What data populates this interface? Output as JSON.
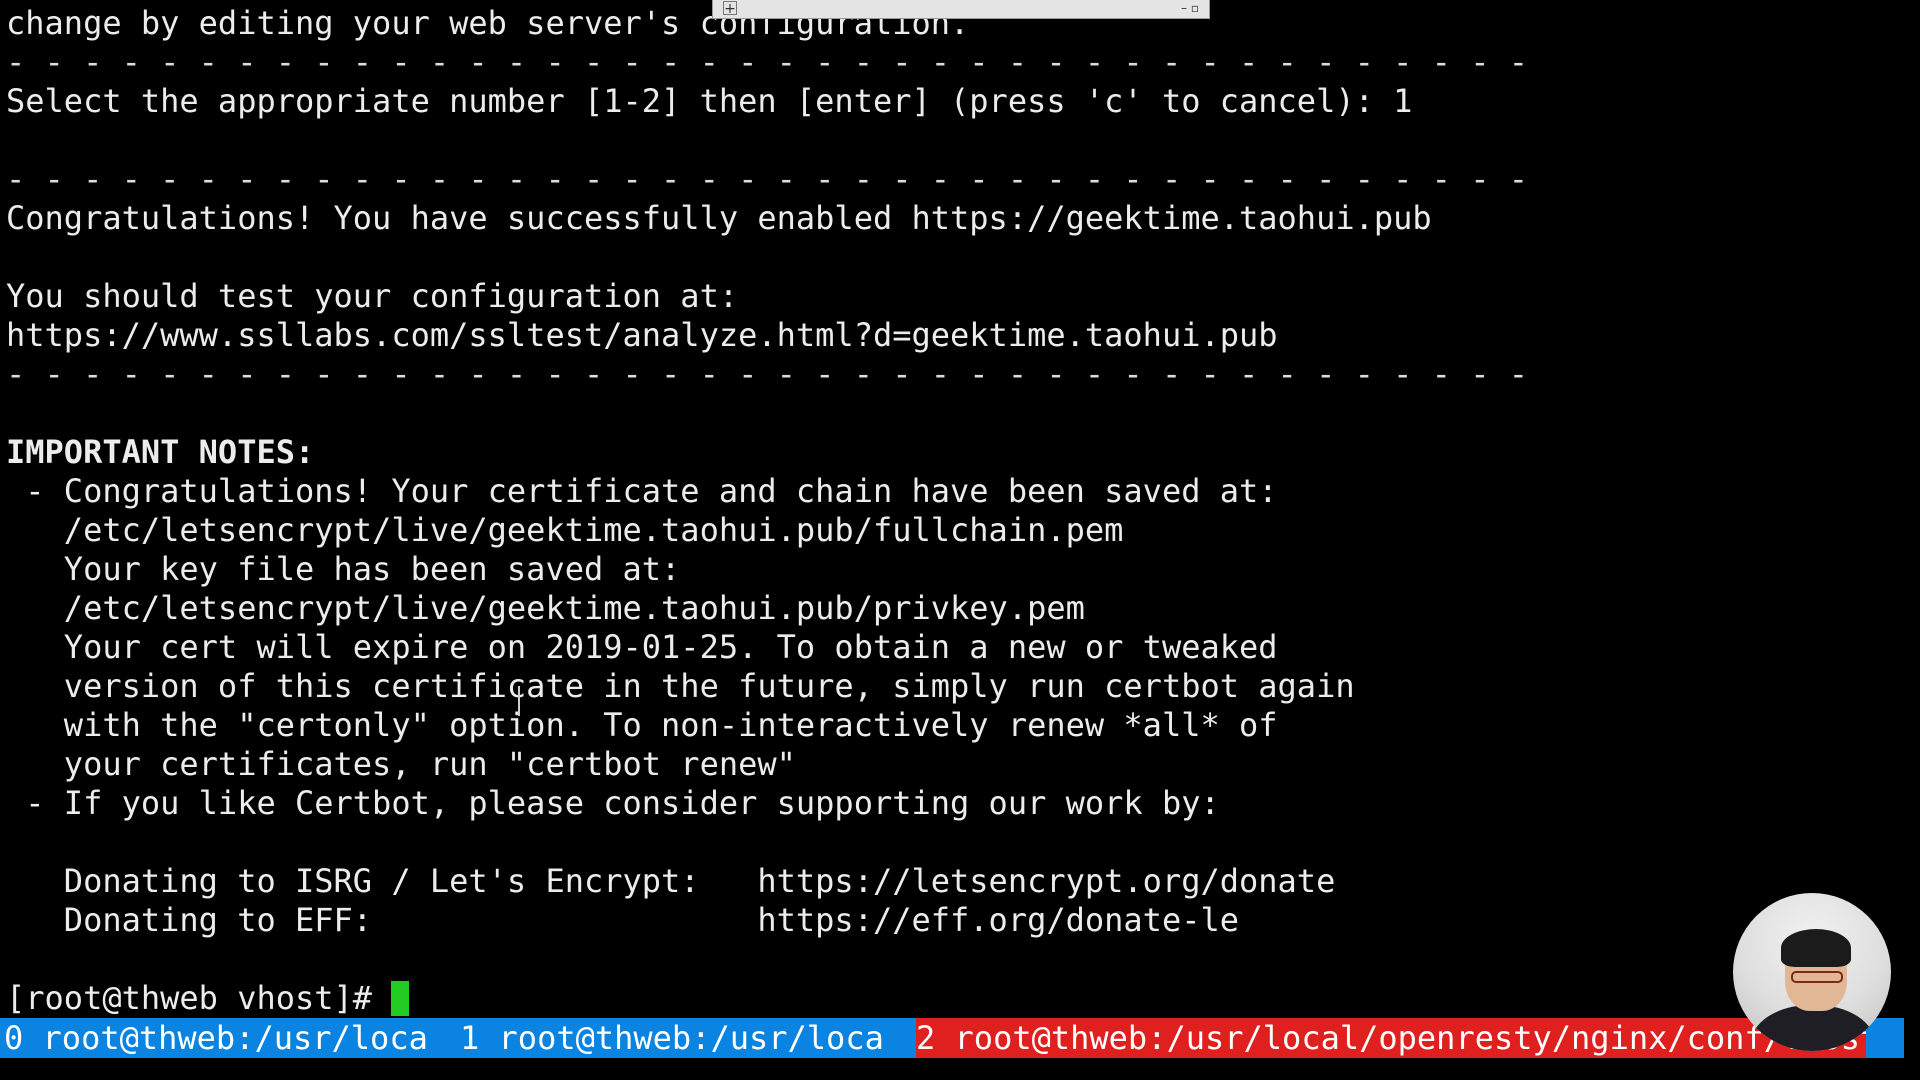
{
  "terminal": {
    "lines": [
      "change by editing your web server's configuration.",
      "- - - - - - - - - - - - - - - - - - - - - - - - - - - - - - - - - - - - - - - -",
      "Select the appropriate number [1-2] then [enter] (press 'c' to cancel): 1",
      "- - - - - - - - - - - - - - - - - - - - - - - - - - - - - - - - - - - - - - - -",
      "Congratulations! You have successfully enabled https://geektime.taohui.pub",
      "You should test your configuration at:",
      "https://www.ssllabs.com/ssltest/analyze.html?d=geektime.taohui.pub",
      "- - - - - - - - - - - - - - - - - - - - - - - - - - - - - - - - - - - - - - - -",
      "IMPORTANT NOTES:",
      " - Congratulations! Your certificate and chain have been saved at:",
      "   /etc/letsencrypt/live/geektime.taohui.pub/fullchain.pem",
      "   Your key file has been saved at:",
      "   /etc/letsencrypt/live/geektime.taohui.pub/privkey.pem",
      "   Your cert will expire on 2019-01-25. To obtain a new or tweaked",
      "   version of this certificate in the future, simply run certbot again",
      "   with the \"certonly\" option. To non-interactively renew *all* of",
      "   your certificates, run \"certbot renew\"",
      " - If you like Certbot, please consider supporting our work by:",
      "   Donating to ISRG / Let's Encrypt:   https://letsencrypt.org/donate",
      "   Donating to EFF:                    https://eff.org/donate-le"
    ],
    "prompt": "[root@thweb vhost]# "
  },
  "status_bar": {
    "windows": [
      "0 root@thweb:/usr/loca",
      "1 root@thweb:/usr/loca",
      "2 root@thweb:/usr/local/openresty/nginx/conf/vhost"
    ],
    "active_index": 2
  },
  "colors": {
    "status_bar_bg": "#0a84e0",
    "active_window_bg": "#e0201e",
    "cursor": "#22cc22"
  }
}
